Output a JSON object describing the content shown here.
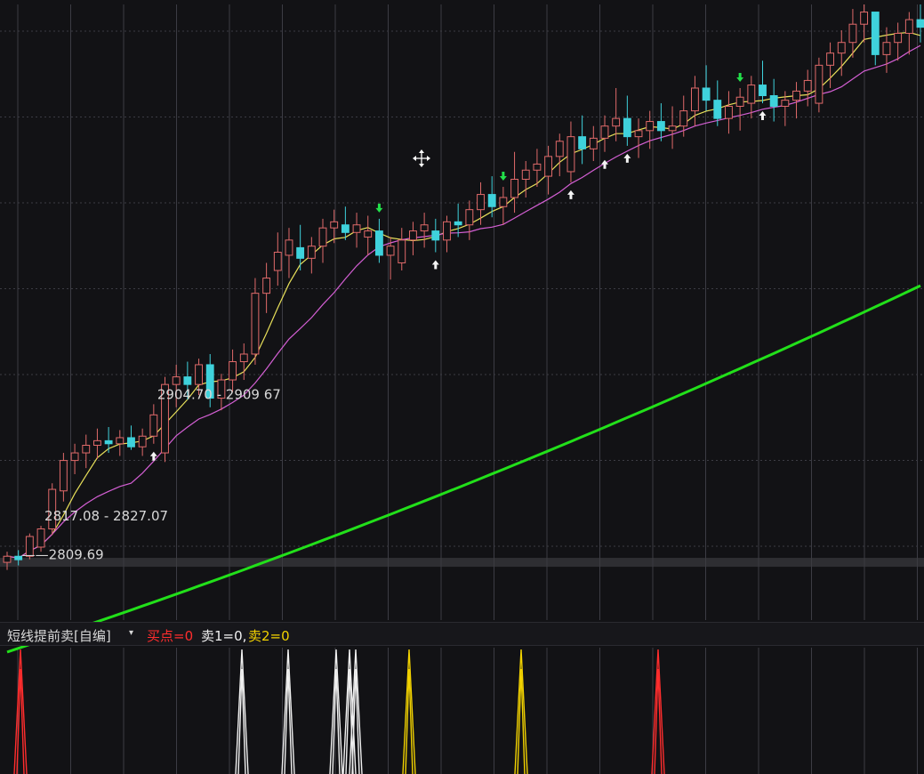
{
  "indicator": {
    "name": "短线提前卖[自编]",
    "buy_label": "买点=0",
    "sell1_label": "卖1=0,",
    "sell2_label": "卖2=0",
    "colors": {
      "buy": "#ff2d2d",
      "sell1": "#f0f0f0",
      "sell2": "#f2d200"
    }
  },
  "chart_data": [
    {
      "type": "candlestick",
      "grid": true,
      "colors": {
        "up": "#e06a6a",
        "down": "#3fd2dc",
        "ma_short": "#e8e05a",
        "ma_mid": "#d45fd4",
        "ma_long": "#22e01a",
        "grid": "#3c3c44",
        "arrow": "#f4f4f4",
        "sell_arrow": "#22e04a"
      },
      "annotations": [
        {
          "text": "2904.70 - 2909 67",
          "at_index": 13
        },
        {
          "text": "2817.08 - 2827.07",
          "at_index": 3
        },
        {
          "text": "2809.69",
          "at_index": 1
        }
      ],
      "price_range": [
        2770,
        3175
      ],
      "long_ma": {
        "start": 2749,
        "end": 2990
      },
      "candles": [
        [
          2808,
          2815,
          2803,
          2812
        ],
        [
          2812,
          2816,
          2806,
          2809.7
        ],
        [
          2812,
          2827,
          2810,
          2825
        ],
        [
          2818,
          2832,
          2815,
          2830
        ],
        [
          2830,
          2860,
          2826,
          2856
        ],
        [
          2855,
          2880,
          2848,
          2875
        ],
        [
          2875,
          2886,
          2866,
          2880
        ],
        [
          2880,
          2892,
          2870,
          2885
        ],
        [
          2885,
          2896,
          2876,
          2888
        ],
        [
          2888,
          2897,
          2880,
          2886
        ],
        [
          2886,
          2895,
          2878,
          2890
        ],
        [
          2890,
          2898,
          2882,
          2884
        ],
        [
          2884,
          2896,
          2878,
          2891
        ],
        [
          2891,
          2912,
          2886,
          2905
        ],
        [
          2880,
          2930,
          2874,
          2925
        ],
        [
          2925,
          2938,
          2910,
          2930
        ],
        [
          2930,
          2940,
          2915,
          2925
        ],
        [
          2925,
          2942,
          2918,
          2938
        ],
        [
          2938,
          2945,
          2910,
          2916
        ],
        [
          2916,
          2932,
          2908,
          2928
        ],
        [
          2928,
          2948,
          2920,
          2940
        ],
        [
          2940,
          2952,
          2928,
          2945
        ],
        [
          2945,
          2995,
          2938,
          2985
        ],
        [
          2985,
          3005,
          2972,
          2995
        ],
        [
          3000,
          3025,
          2990,
          3012
        ],
        [
          3010,
          3028,
          2995,
          3020
        ],
        [
          3015,
          3030,
          3000,
          3008
        ],
        [
          3008,
          3022,
          2998,
          3016
        ],
        [
          3016,
          3034,
          3005,
          3028
        ],
        [
          3028,
          3040,
          3018,
          3032
        ],
        [
          3030,
          3042,
          3020,
          3025
        ],
        [
          3025,
          3038,
          3015,
          3030
        ],
        [
          3022,
          3036,
          3010,
          3026
        ],
        [
          3026,
          3034,
          3005,
          3010
        ],
        [
          3010,
          3022,
          2994,
          3016
        ],
        [
          3005,
          3028,
          3000,
          3020
        ],
        [
          3020,
          3032,
          3010,
          3026
        ],
        [
          3026,
          3038,
          3015,
          3030
        ],
        [
          3026,
          3034,
          3012,
          3020
        ],
        [
          3020,
          3036,
          3012,
          3032
        ],
        [
          3032,
          3044,
          3022,
          3030
        ],
        [
          3030,
          3046,
          3020,
          3040
        ],
        [
          3040,
          3058,
          3030,
          3050
        ],
        [
          3050,
          3062,
          3035,
          3042
        ],
        [
          3042,
          3055,
          3030,
          3048
        ],
        [
          3048,
          3078,
          3038,
          3060
        ],
        [
          3060,
          3072,
          3048,
          3066
        ],
        [
          3066,
          3080,
          3055,
          3070
        ],
        [
          3062,
          3082,
          3050,
          3075
        ],
        [
          3075,
          3090,
          3062,
          3085
        ],
        [
          3065,
          3098,
          3058,
          3088
        ],
        [
          3088,
          3102,
          3070,
          3080
        ],
        [
          3080,
          3095,
          3072,
          3087
        ],
        [
          3087,
          3102,
          3078,
          3095
        ],
        [
          3095,
          3120,
          3085,
          3100
        ],
        [
          3100,
          3115,
          3082,
          3088
        ],
        [
          3088,
          3100,
          3074,
          3092
        ],
        [
          3092,
          3105,
          3080,
          3098
        ],
        [
          3098,
          3110,
          3085,
          3092
        ],
        [
          3092,
          3108,
          3080,
          3095
        ],
        [
          3095,
          3115,
          3088,
          3105
        ],
        [
          3105,
          3128,
          3095,
          3120
        ],
        [
          3120,
          3135,
          3105,
          3112
        ],
        [
          3112,
          3125,
          3095,
          3100
        ],
        [
          3100,
          3118,
          3090,
          3108
        ],
        [
          3108,
          3120,
          3092,
          3114
        ],
        [
          3110,
          3128,
          3100,
          3122
        ],
        [
          3122,
          3138,
          3110,
          3115
        ],
        [
          3115,
          3126,
          3098,
          3108
        ],
        [
          3108,
          3118,
          3095,
          3112
        ],
        [
          3112,
          3124,
          3100,
          3118
        ],
        [
          3118,
          3132,
          3108,
          3125
        ],
        [
          3110,
          3140,
          3104,
          3135
        ],
        [
          3135,
          3150,
          3120,
          3143
        ],
        [
          3143,
          3158,
          3128,
          3150
        ],
        [
          3150,
          3172,
          3140,
          3162
        ],
        [
          3162,
          3175,
          3150,
          3170
        ],
        [
          3170,
          3168,
          3135,
          3142
        ],
        [
          3142,
          3160,
          3130,
          3150
        ],
        [
          3150,
          3163,
          3138,
          3156
        ],
        [
          3156,
          3170,
          3142,
          3165
        ],
        [
          3165,
          3175,
          3150,
          3160
        ]
      ]
    }
  ]
}
